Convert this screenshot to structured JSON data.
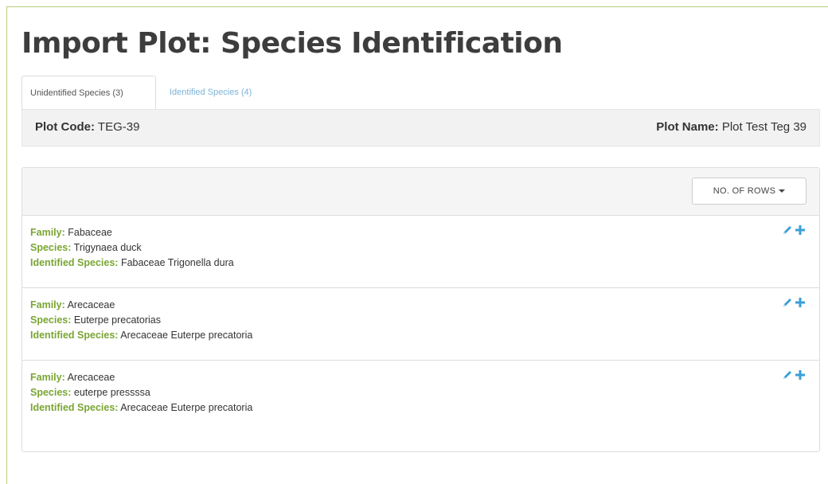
{
  "page": {
    "title": "Import Plot: Species Identification",
    "accent_green": "#7aa532",
    "action_blue": "#3a9fd8"
  },
  "tabs": [
    {
      "label": "Unidentified Species (3)",
      "active": true
    },
    {
      "label": "Identified Species (4)",
      "active": false
    }
  ],
  "plot": {
    "code_label": "Plot Code:",
    "code_value": "TEG-39",
    "name_label": "Plot Name:",
    "name_value": "Plot Test Teg 39"
  },
  "toolbar": {
    "rows_button_label": "NO. OF ROWS"
  },
  "labels": {
    "family": "Family:",
    "species": "Species:",
    "identified": "Identified Species:"
  },
  "icons": {
    "edit": "pencil-icon",
    "add": "plus-icon"
  },
  "rows": [
    {
      "family": "Fabaceae",
      "species": "Trigynaea duck",
      "identified": "Fabaceae Trigonella dura"
    },
    {
      "family": "Arecaceae",
      "species": "Euterpe precatorias",
      "identified": "Arecaceae Euterpe precatoria"
    },
    {
      "family": "Arecaceae",
      "species": "euterpe pressssa",
      "identified": "Arecaceae Euterpe precatoria"
    }
  ]
}
